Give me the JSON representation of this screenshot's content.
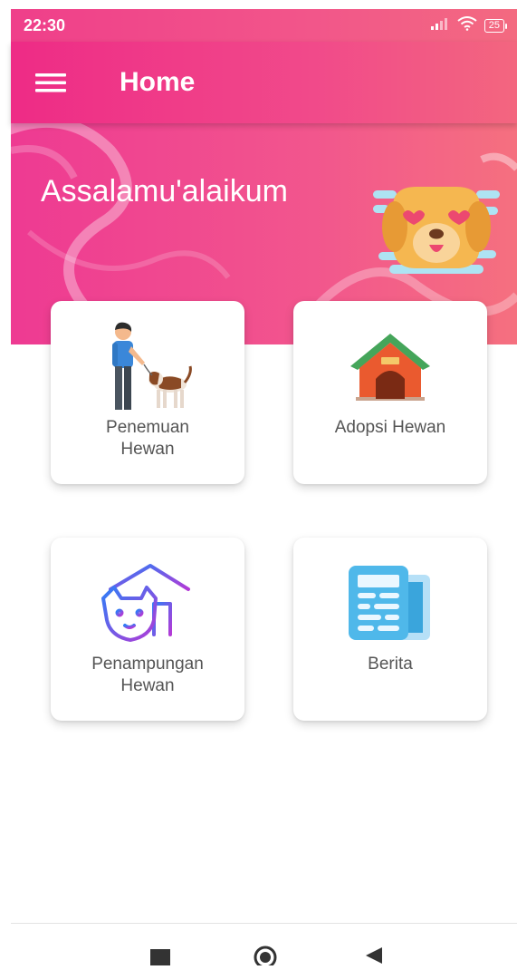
{
  "status_bar": {
    "time": "22:30",
    "battery_level": "25"
  },
  "app_bar": {
    "title": "Home",
    "menu_icon": "hamburger-menu-icon"
  },
  "banner": {
    "greeting": "Assalamu'alaikum",
    "illustration": "dog-heart-eyes-icon"
  },
  "cards": [
    {
      "label": "Penemuan\nHewan",
      "icon": "person-walking-dog-icon"
    },
    {
      "label": "Adopsi Hewan",
      "icon": "dog-house-icon"
    },
    {
      "label": "Penampungan\nHewan",
      "icon": "animal-shelter-icon"
    },
    {
      "label": "Berita",
      "icon": "newspaper-icon"
    }
  ],
  "nav_bar": {
    "buttons": [
      "recent-apps-icon",
      "home-circle-icon",
      "back-triangle-icon"
    ]
  },
  "colors": {
    "primary": "#ee2b86",
    "accent": "#f3667f",
    "card_text": "#555555"
  }
}
